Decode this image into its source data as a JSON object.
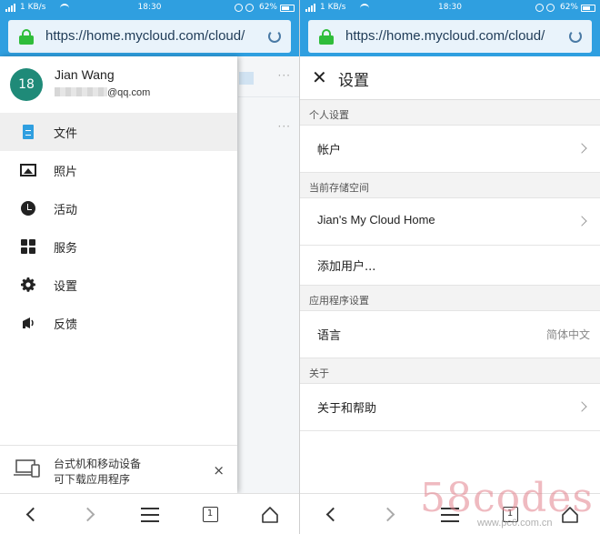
{
  "status_bar": {
    "network_speed": "1 KB/s",
    "time": "18:30",
    "battery": "62%"
  },
  "browser": {
    "url": "https://home.mycloud.com/cloud/",
    "tab_count": "1"
  },
  "drawer": {
    "avatar_text": "18",
    "user_name": "Jian Wang",
    "user_email_domain": "@qq.com",
    "menu": [
      {
        "label": "文件",
        "icon": "file-icon",
        "active": true
      },
      {
        "label": "照片",
        "icon": "photo-icon"
      },
      {
        "label": "活动",
        "icon": "clock-icon"
      },
      {
        "label": "服务",
        "icon": "apps-icon"
      },
      {
        "label": "设置",
        "icon": "gear-icon"
      },
      {
        "label": "反馈",
        "icon": "megaphone-icon"
      }
    ],
    "promo": {
      "line1": "台式机和移动设备",
      "line2": "可下载应用程序",
      "close": "×"
    }
  },
  "settings": {
    "close": "✕",
    "title": "设置",
    "sections": [
      {
        "header": "个人设置",
        "rows": [
          {
            "label": "帐户",
            "chevron": true
          }
        ]
      },
      {
        "header": "当前存储空间",
        "rows": [
          {
            "label": "Jian's My Cloud Home",
            "chevron": true
          },
          {
            "label": "添加用户..."
          }
        ]
      },
      {
        "header": "应用程序设置",
        "rows": [
          {
            "label": "语言",
            "value": "简体中文"
          }
        ]
      },
      {
        "header": "关于",
        "rows": [
          {
            "label": "关于和帮助",
            "chevron": true
          }
        ]
      }
    ]
  },
  "watermark": {
    "logo": "58codes",
    "url": "www.pc6.com.cn"
  },
  "colors": {
    "browser_bar": "#2f9fe0",
    "lock": "#2fbd3a",
    "avatar": "#1f8a78",
    "file_icon": "#2f9fe0"
  }
}
